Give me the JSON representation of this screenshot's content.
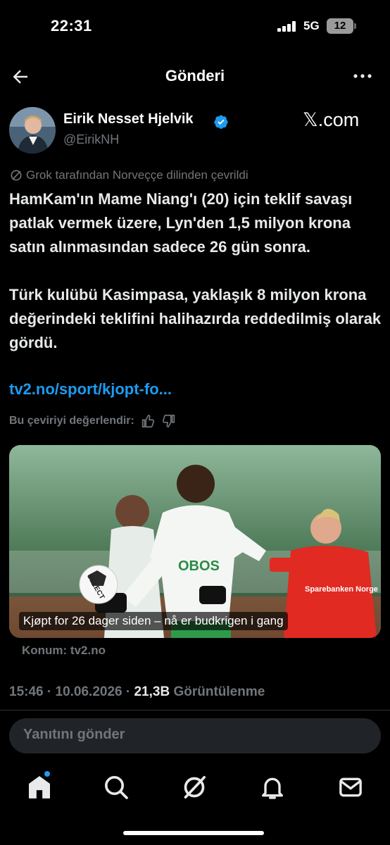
{
  "status_bar": {
    "time": "22:31",
    "network": "5G",
    "battery": "12"
  },
  "nav": {
    "title": "Gönderi"
  },
  "author": {
    "name": "Eirik Nesset Hjelvik",
    "handle": "@EirikNH",
    "source": "𝕏.com"
  },
  "translation_note": "Grok tarafından Norveççe dilinden çevrildi",
  "tweet": {
    "paragraph1": "HamKam'ın Mame Niang'ı (20) için teklif savaşı patlak vermek üzere, Lyn'den 1,5 milyon krona satın alınmasından sadece 26 gün sonra.",
    "paragraph2": "Türk kulübü Kasimpasa, yaklaşık 8 milyon krona değerindeki teklifini halihazırda reddedilmiş olarak gördü.",
    "link": "tv2.no/sport/kjopt-fo..."
  },
  "rate_translation": "Bu çeviriyi değerlendir:",
  "card": {
    "caption": "Kjøpt for 26 dager siden – nå er budkrigen i gang",
    "source": "Konum: tv2.no",
    "shirt_text": "OBOS",
    "ball_text": "SELECT",
    "sponsor_text": "Sparebanken Norge"
  },
  "meta": {
    "time": "15:46",
    "date": "10.06.2026",
    "views": "21,3B",
    "views_label": "Görüntülenme",
    "separator": "·"
  },
  "reply": {
    "placeholder": "Yanıtını gönder"
  },
  "colors": {
    "accent": "#1d9bf0",
    "background": "#000000",
    "muted": "#71767b"
  }
}
